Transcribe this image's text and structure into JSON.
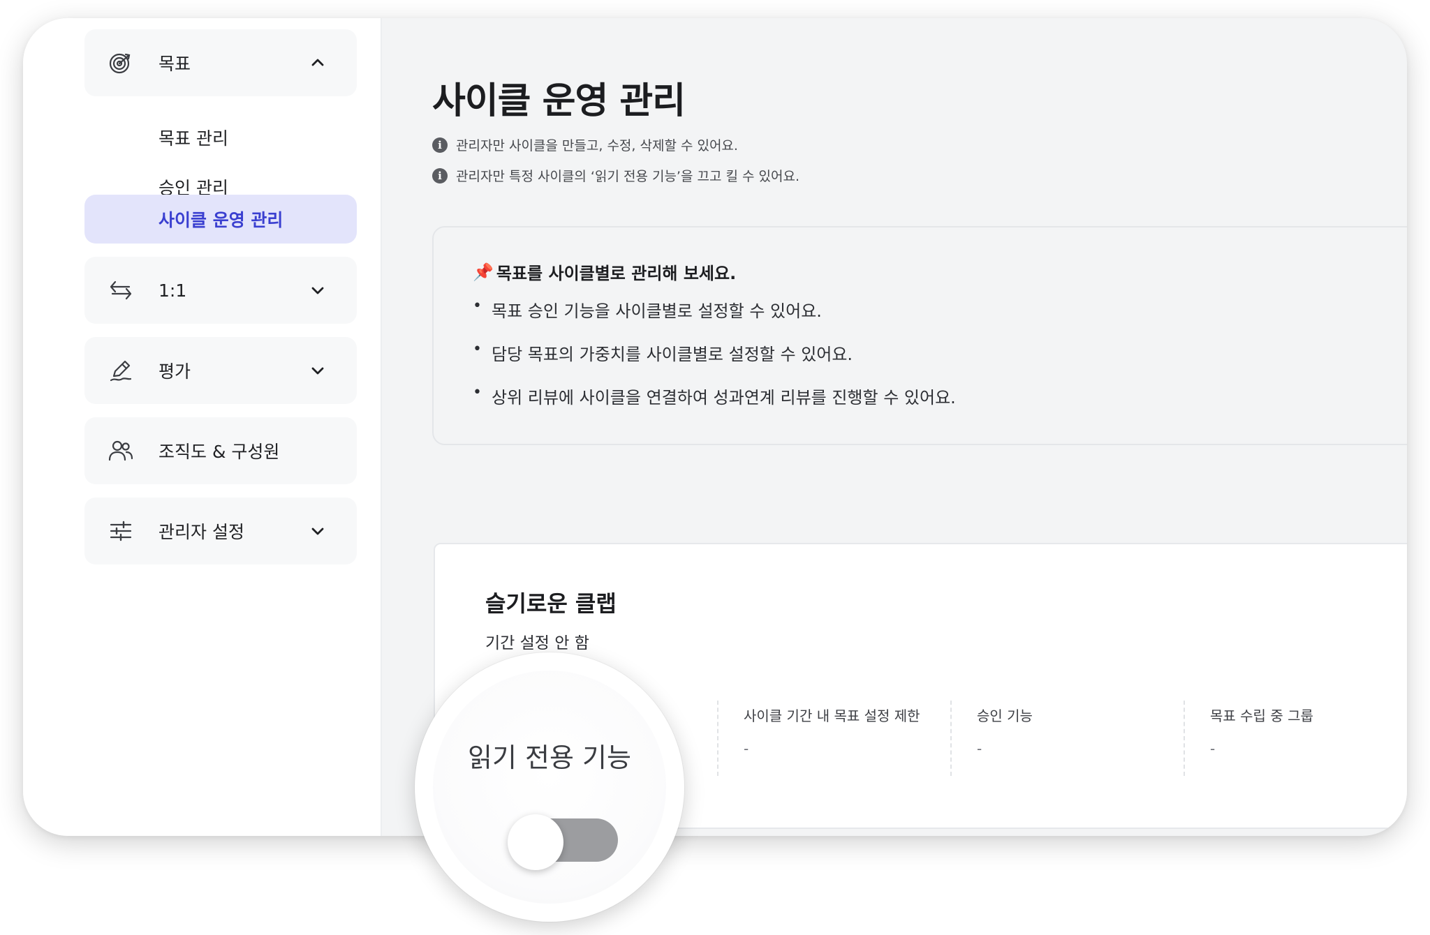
{
  "sidebar": {
    "goal_group": {
      "label": "목표",
      "icon": "target-icon",
      "expanded": true
    },
    "goal_items": [
      {
        "label": "목표 관리"
      },
      {
        "label": "승인 관리"
      },
      {
        "label": "사이클 운영 관리",
        "active": true
      }
    ],
    "one_on_one": {
      "label": "1:1",
      "icon": "swap-arrows-icon"
    },
    "evaluation": {
      "label": "평가",
      "icon": "pen-edit-icon"
    },
    "org": {
      "label": "조직도 & 구성원",
      "icon": "people-icon"
    },
    "admin": {
      "label": "관리자 설정",
      "icon": "sliders-icon"
    }
  },
  "main": {
    "title": "사이클 운영 관리",
    "notices": [
      "관리자만 사이클을 만들고, 수정, 삭제할 수 있어요.",
      "관리자만 특정 사이클의 ‘읽기 전용 기능’을 끄고 킬 수 있어요."
    ],
    "callout": {
      "title": "목표를 사이클별로 관리해 보세요.",
      "items": [
        "목표 승인 기능을 사이클별로 설정할 수 있어요.",
        "담당 목표의 가중치를 사이클별로 설정할 수 있어요.",
        "상위 리뷰에 사이클을 연결하여 성과연계 리뷰를 진행할 수 있어요."
      ]
    },
    "cycle_card": {
      "name": "슬기로운 클랩",
      "period": "기간 설정 안 함",
      "columns": [
        {
          "header": "사이클 기간 내 목표 설정 제한",
          "value": "-"
        },
        {
          "header": "승인 기능",
          "value": "-"
        },
        {
          "header": "목표 수립 중 그룹",
          "value": "-"
        }
      ]
    }
  },
  "zoom": {
    "label": "읽기 전용 기능",
    "toggle_on": false
  },
  "colors": {
    "accent": "#3a3fd0",
    "active_bg": "#e3e4fb",
    "toggle_off": "#9c9da0",
    "pin": "#d63a3a"
  }
}
